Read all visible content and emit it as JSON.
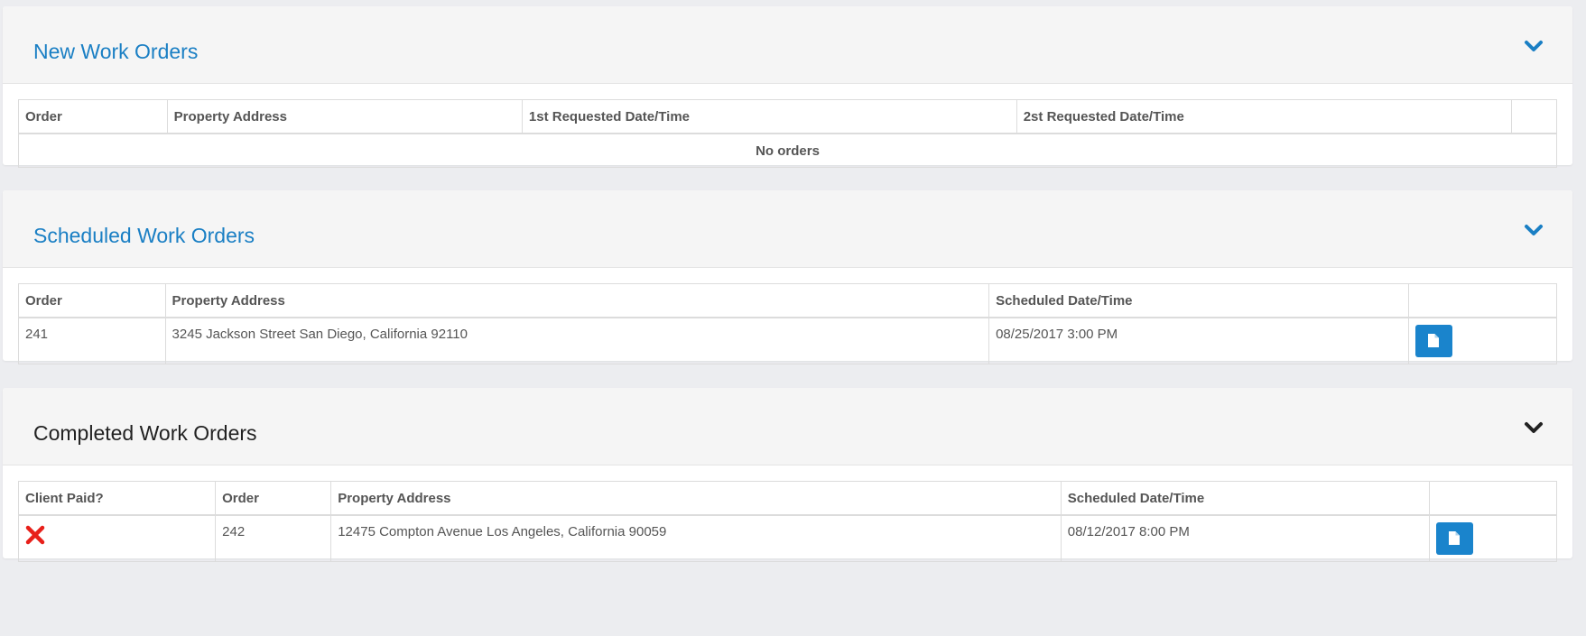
{
  "panels": {
    "new": {
      "title": "New Work Orders",
      "columns": [
        "Order",
        "Property Address",
        "1st Requested Date/Time",
        "2st Requested Date/Time",
        ""
      ],
      "empty_text": "No orders"
    },
    "scheduled": {
      "title": "Scheduled Work Orders",
      "columns": [
        "Order",
        "Property Address",
        "Scheduled Date/Time",
        ""
      ],
      "rows": [
        {
          "order": "241",
          "address": "3245 Jackson Street San Diego, California 92110",
          "datetime": "08/25/2017 3:00 PM"
        }
      ]
    },
    "completed": {
      "title": "Completed Work Orders",
      "columns": [
        "Client Paid?",
        "Order",
        "Property Address",
        "Scheduled Date/Time",
        ""
      ],
      "rows": [
        {
          "client_paid": "no",
          "order": "242",
          "address": "12475 Compton Avenue Los Angeles, California 90059",
          "datetime": "08/12/2017 8:00 PM"
        }
      ]
    }
  },
  "icons": {
    "chevron": "chevron-down-icon",
    "document": "document-icon",
    "unpaid": "close-icon"
  },
  "colors": {
    "accent": "#1a7fc4",
    "button": "#1a84cc",
    "unpaid_mark": "#e8201a",
    "background": "#ecedf0"
  }
}
